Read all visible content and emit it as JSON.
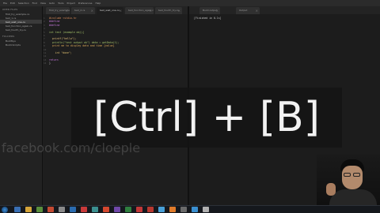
{
  "menubar": {
    "items": [
      "File",
      "Edit",
      "Selection",
      "Find",
      "View",
      "Goto",
      "Tools",
      "Project",
      "Preferences",
      "Help"
    ]
  },
  "sidebar": {
    "open_files_header": "OPEN FILES",
    "open_files": [
      "first_try_example.cs",
      "test_1.cs",
      "test_wait_one.cs",
      "test_function_again.cs",
      "test_fourth_try.cs"
    ],
    "folders_header": "FOLDERS",
    "folders": [
      "BuildSys",
      "Build-Scripts"
    ]
  },
  "tabs": [
    {
      "label": "first_try_example.cs",
      "active": false
    },
    {
      "label": "test_2.cs",
      "active": false
    },
    {
      "label": "test_wait_one.cs",
      "active": true
    },
    {
      "label": "test_function_again.cs",
      "active": false
    },
    {
      "label": "test_fourth_try.cs",
      "active": false
    },
    {
      "label": "Build output",
      "active": false
    },
    {
      "label": "Output",
      "active": false
    }
  ],
  "editor": {
    "lines": [
      {
        "n": "1",
        "text": "#include <stdio.h>"
      },
      {
        "n": "2",
        "text": "#define"
      },
      {
        "n": "3",
        "text": "#define"
      },
      {
        "n": "4",
        "text": ""
      },
      {
        "n": "5",
        "text": "int test (example obj){"
      },
      {
        "n": "6",
        "text": ""
      },
      {
        "n": "7",
        "text": "  printf(\"hello\");"
      },
      {
        "n": "8",
        "text": "  println(\"test output ok\") data = getData(1);"
      },
      {
        "n": "9",
        "text": "  print me to display data and time {value}"
      },
      {
        "n": "10",
        "text": ""
      },
      {
        "n": "11",
        "text": "    int \"done\";"
      },
      {
        "n": "12",
        "text": ""
      },
      {
        "n": "13",
        "text": "return"
      },
      {
        "n": "14",
        "text": "}"
      }
    ]
  },
  "output": {
    "text": "[Finished in 0.1s]"
  },
  "overlay": {
    "keystroke": "[Ctrl] + [B]"
  },
  "watermark": {
    "text": "facebook.com/cloeple"
  },
  "taskbar": {
    "icon_colors": [
      "#3a6fb3",
      "#d6a53a",
      "#5a8f3c",
      "#c44a32",
      "#8a8a8a",
      "#2b6cb0",
      "#c93a3a",
      "#3b8f8f",
      "#d4482f",
      "#7048a8",
      "#2f7f3f",
      "#c23838",
      "#b8382f",
      "#48a0d8",
      "#e07b2a",
      "#6a6a6a",
      "#3a8fd0",
      "#b0b0b0"
    ]
  }
}
